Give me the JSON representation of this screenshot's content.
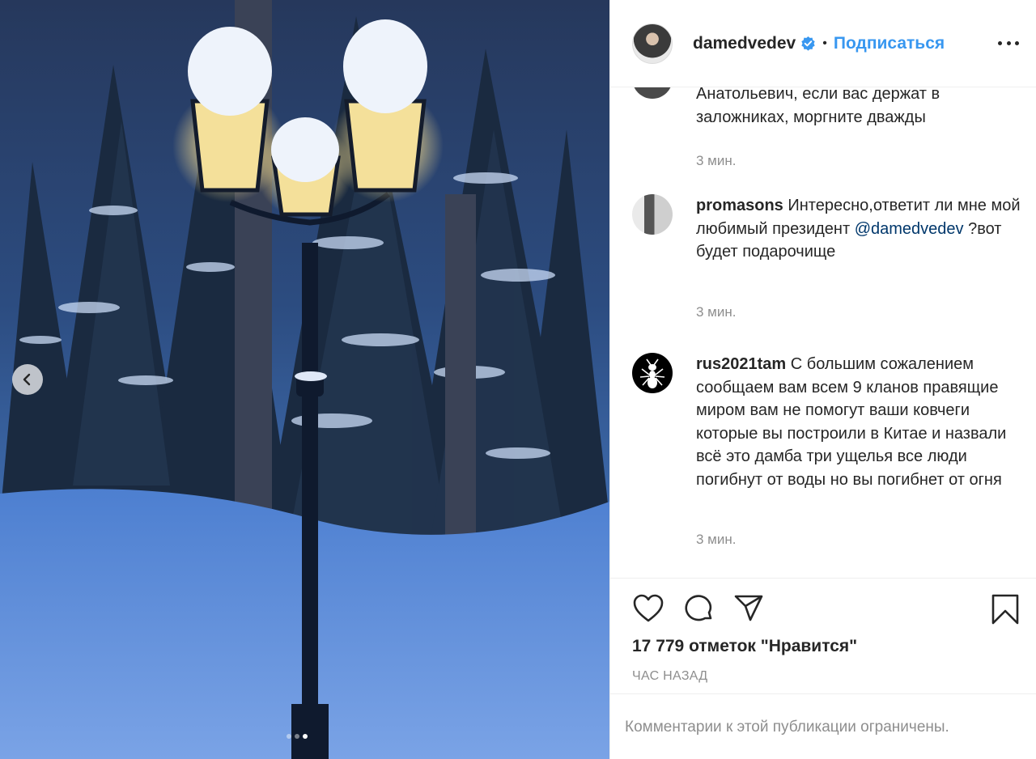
{
  "post": {
    "username": "damedvedev",
    "follow_label": "Подписаться",
    "bullet": "•",
    "likes_text": "17 779 отметок \"Нравится\"",
    "posted_time": "ЧАС НАЗАД",
    "comments_limited": "Комментарии к этой публикации ограничены."
  },
  "carousel": {
    "total": 3,
    "active": 3
  },
  "comments": [
    {
      "user": "",
      "text": "Анатольевич, если вас держат в заложниках, моргните дважды",
      "time": "3 мин."
    },
    {
      "user": "promasons",
      "text": "Интересно,ответит ли мне мой любимый президент",
      "mention": "@damedvedev",
      "text_after": "?вот будет подарочище",
      "time": "3 мин."
    },
    {
      "user": "rus2021tam",
      "text": "С большим сожалением сообщаем вам всем 9 кланов правящие миром вам не помогут ваши ковчеги которые вы построили в Китае и назвали всё это дамба три ущелья все люди погибнут от воды но вы погибнет от огня",
      "time": "3 мин."
    }
  ],
  "icons": {
    "verified": "verified-badge-icon",
    "more": "more-options-icon",
    "like": "heart-icon",
    "comment": "comment-icon",
    "share": "share-icon",
    "save": "bookmark-icon",
    "prev": "chevron-left-icon"
  },
  "colors": {
    "accent": "#3897f0",
    "mention": "#00376b",
    "muted": "#8e8e8e",
    "text": "#262626"
  }
}
